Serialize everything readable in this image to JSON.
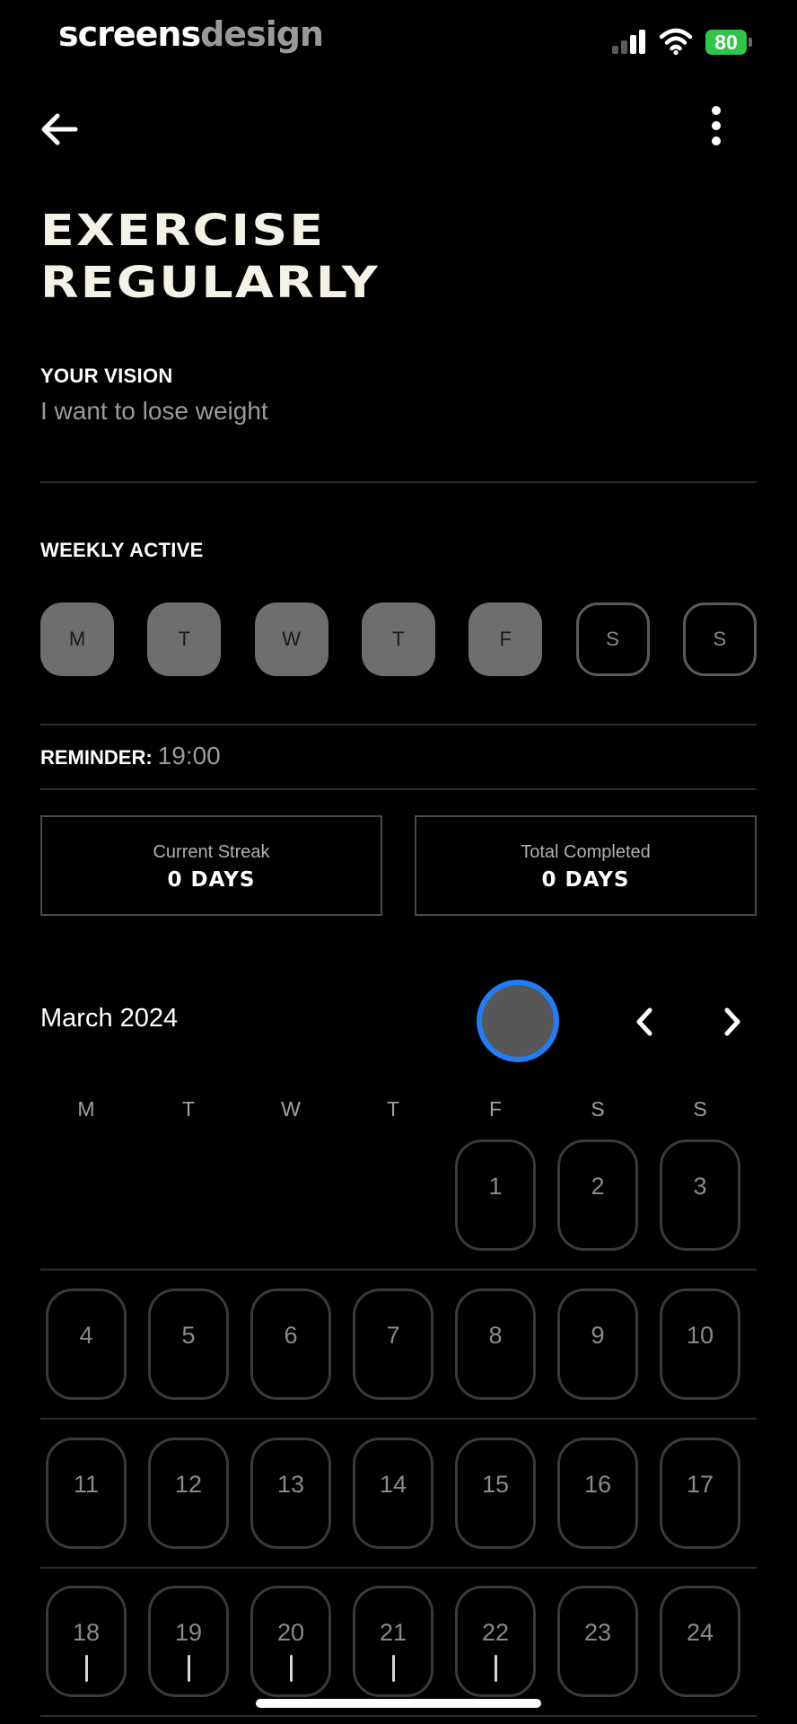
{
  "status_bar": {
    "brand_part1": "screens",
    "brand_part2": "design",
    "battery": "80",
    "battery_color": "#30c64a"
  },
  "nav": {
    "back_icon": "arrow-left-icon",
    "more_icon": "more-vertical-icon"
  },
  "habit": {
    "title_line1": "EXERCISE",
    "title_line2": "REGULARLY"
  },
  "vision": {
    "label": "YOUR VISION",
    "text": "I want to lose weight"
  },
  "weekly": {
    "label": "WEEKLY ACTIVE",
    "days": [
      {
        "label": "M",
        "active": true
      },
      {
        "label": "T",
        "active": true
      },
      {
        "label": "W",
        "active": true
      },
      {
        "label": "T",
        "active": true
      },
      {
        "label": "F",
        "active": true
      },
      {
        "label": "S",
        "active": false
      },
      {
        "label": "S",
        "active": false
      }
    ]
  },
  "reminder": {
    "label": "REMINDER:",
    "time": "19:00"
  },
  "stats": {
    "current_streak": {
      "label": "Current Streak",
      "value": "0 DAYS"
    },
    "total_completed": {
      "label": "Total Completed",
      "value": "0 DAYS"
    }
  },
  "calendar": {
    "month": "March 2024",
    "accent_color": "#1f7ef5",
    "weekday_headers": [
      "M",
      "T",
      "W",
      "T",
      "F",
      "S",
      "S"
    ],
    "first_weekday_index": 4,
    "days": [
      "1",
      "2",
      "3",
      "4",
      "5",
      "6",
      "7",
      "8",
      "9",
      "10",
      "11",
      "12",
      "13",
      "14",
      "15",
      "16",
      "17",
      "18",
      "19",
      "20",
      "21",
      "22",
      "23",
      "24"
    ],
    "marked_days": [
      "18",
      "19",
      "20",
      "21",
      "22"
    ]
  }
}
